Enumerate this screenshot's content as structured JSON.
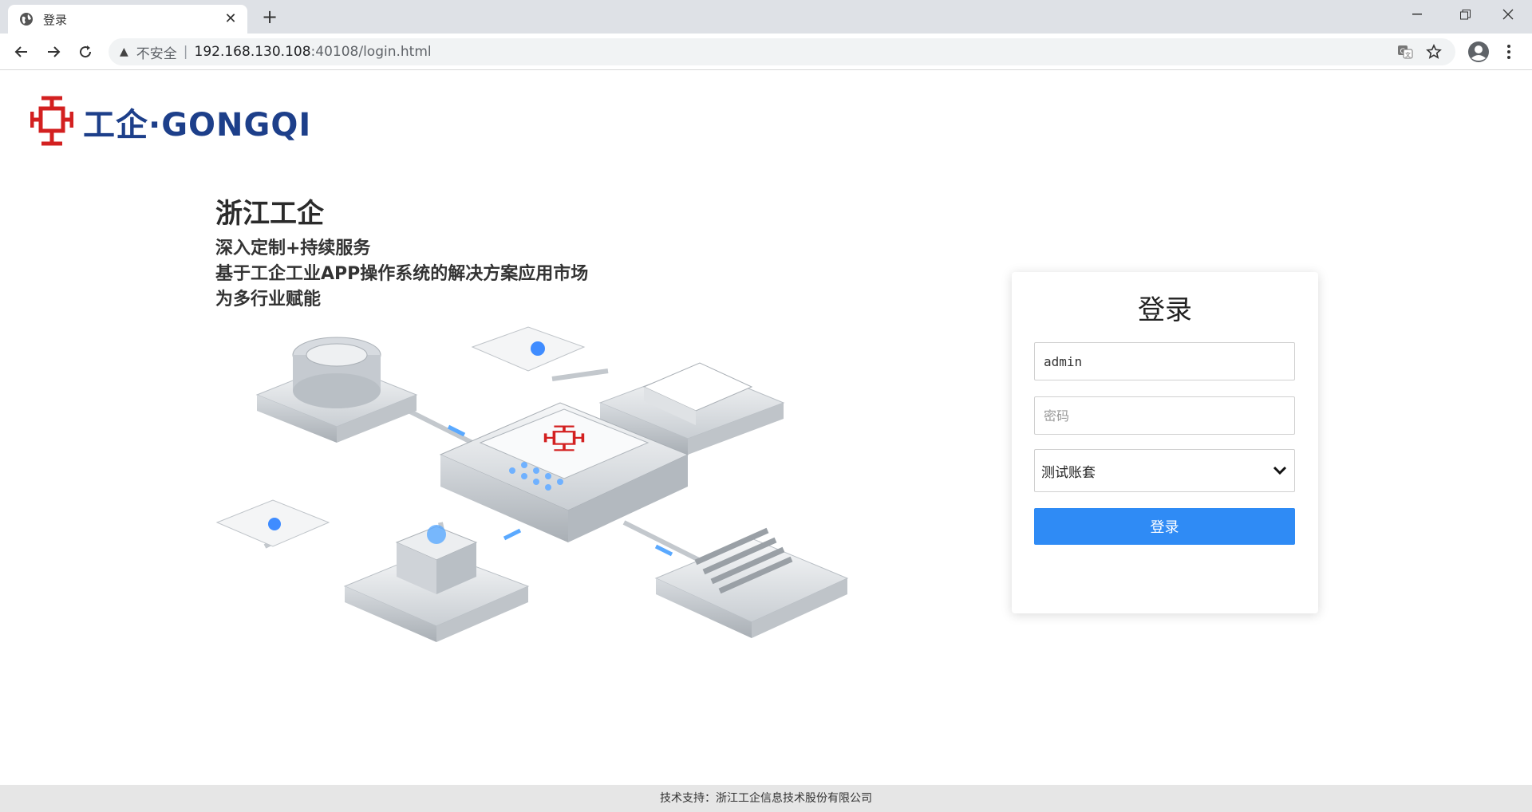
{
  "browser": {
    "tab_title": "登录",
    "url_warning": "不安全",
    "url_host": "192.168.130.108",
    "url_path": ":40108/login.html"
  },
  "logo": {
    "text": "工企·GONGQI"
  },
  "hero": {
    "title": "浙江工企",
    "lines": [
      "深入定制+持续服务",
      "基于工企工业APP操作系统的解决方案应用市场",
      "为多行业赋能"
    ]
  },
  "login": {
    "title": "登录",
    "username_value": "admin",
    "password_placeholder": "密码",
    "account_set": "测试账套",
    "submit_label": "登录"
  },
  "footer": {
    "text": "技术支持：浙江工企信息技术股份有限公司"
  },
  "colors": {
    "brand_red": "#d32020",
    "brand_blue": "#1d3f8a",
    "button_blue": "#2f8bf5"
  }
}
